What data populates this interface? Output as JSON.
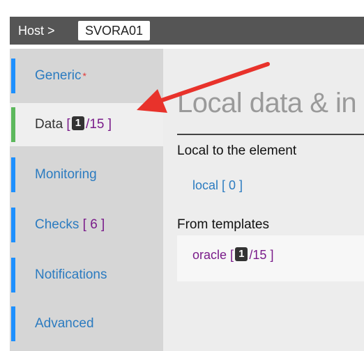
{
  "header": {
    "label": "Host >",
    "host_name": "SVORA01"
  },
  "sidebar": {
    "items": [
      {
        "label": "Generic",
        "required": "*"
      },
      {
        "label": "Data",
        "bracket_open": "[",
        "badge": "1",
        "count": "/15",
        "bracket_close": "]"
      },
      {
        "label": "Monitoring"
      },
      {
        "label": "Checks",
        "count": "[ 6 ]"
      },
      {
        "label": "Notifications"
      },
      {
        "label": "Advanced"
      }
    ]
  },
  "main": {
    "title": "Local data & in",
    "local_section": {
      "label": "Local to the element",
      "link_label": "local",
      "link_count": "[ 0 ]"
    },
    "templates_section": {
      "label": "From templates",
      "template": {
        "name": "oracle",
        "bracket_open": "[",
        "badge": "1",
        "count": "/15",
        "bracket_close": "]"
      }
    }
  },
  "annotation": {
    "arrow_color": "#e8322b"
  }
}
